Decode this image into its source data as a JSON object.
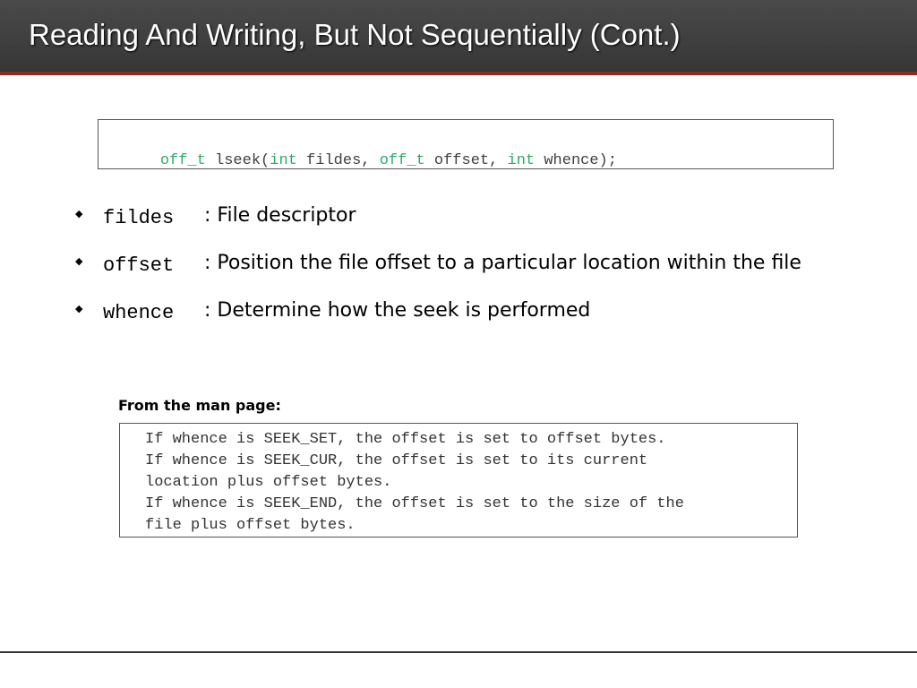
{
  "slide": {
    "title": "Reading And Writing, But Not Sequentially (Cont.)"
  },
  "signature": {
    "tokens": [
      {
        "text": "off_t",
        "keyword": true
      },
      {
        "text": " lseek(",
        "keyword": false
      },
      {
        "text": "int",
        "keyword": true
      },
      {
        "text": " fildes, ",
        "keyword": false
      },
      {
        "text": "off_t",
        "keyword": true
      },
      {
        "text": " offset, ",
        "keyword": false
      },
      {
        "text": "int",
        "keyword": true
      },
      {
        "text": " whence);",
        "keyword": false
      }
    ]
  },
  "bullets": [
    {
      "term": "fildes",
      "desc": ": File descriptor"
    },
    {
      "term": "offset",
      "desc": ": Position the file offset to a particular location within the file"
    },
    {
      "term": "whence",
      "desc": ": Determine how the seek is performed"
    }
  ],
  "man_page": {
    "label": "From the man page:",
    "lines": [
      "If whence is SEEK_SET, the offset is set to offset bytes.",
      "If whence is SEEK_CUR, the offset is set to its current",
      "location plus offset bytes.",
      "If whence is SEEK_END, the offset is set to the size of the",
      "file plus offset bytes."
    ]
  },
  "colors": {
    "title_bar": "#3c3c3c",
    "title_accent": "#8b2e1c",
    "keyword": "#2eaa6b",
    "code_text": "#404040"
  },
  "icons": {
    "bullet": "diamond-bullet-icon"
  }
}
